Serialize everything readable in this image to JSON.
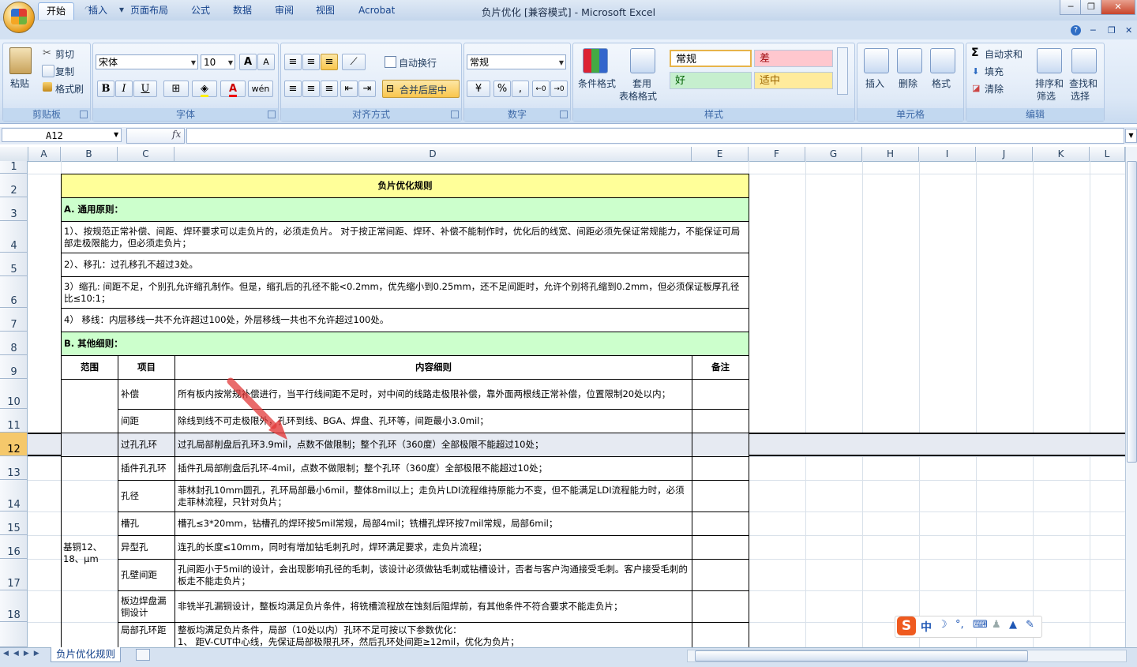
{
  "window": {
    "title": "负片优化  [兼容模式] - Microsoft Excel"
  },
  "tabs": [
    "开始",
    "插入",
    "页面布局",
    "公式",
    "数据",
    "审阅",
    "视图",
    "Acrobat"
  ],
  "ribbon": {
    "clipboard": {
      "paste": "粘贴",
      "cut": "剪切",
      "copy": "复制",
      "format_painter": "格式刷",
      "label": "剪贴板"
    },
    "font": {
      "name": "宋体",
      "size": "10",
      "bold": "B",
      "italic": "I",
      "underline": "U",
      "grow": "A",
      "shrink": "A",
      "label": "字体",
      "phonetic": "wén"
    },
    "alignment": {
      "wrap": "自动换行",
      "merge": "合并后居中",
      "label": "对齐方式"
    },
    "number": {
      "format": "常规",
      "percent": "%",
      "comma": ",",
      "label": "数字"
    },
    "styles": {
      "conditional": "条件格式",
      "table_format_1": "套用",
      "table_format_2": "表格格式",
      "normal": "常规",
      "bad": "差",
      "good": "好",
      "neutral": "适中",
      "label": "样式"
    },
    "cells": {
      "insert": "插入",
      "delete": "删除",
      "format": "格式",
      "label": "单元格"
    },
    "editing": {
      "autosum": "自动求和",
      "fill": "填充",
      "clear": "清除",
      "sort_1": "排序和",
      "sort_2": "筛选",
      "find_1": "查找和",
      "find_2": "选择",
      "label": "编辑"
    }
  },
  "formula_bar": {
    "name_box": "A12",
    "fx": "fx",
    "value": ""
  },
  "columns": [
    "A",
    "B",
    "C",
    "D",
    "E",
    "F",
    "G",
    "H",
    "I",
    "J",
    "K",
    "L"
  ],
  "rows": [
    "1",
    "2",
    "3",
    "4",
    "5",
    "6",
    "7",
    "8",
    "9",
    "10",
    "11",
    "12",
    "13",
    "14",
    "15",
    "16",
    "17",
    "18"
  ],
  "sheet": {
    "title": "负片优化规则",
    "section_a": "A.  通用原则：",
    "rule_1": "1）、按规范正常补偿、间距、焊环要求可以走负片的，必须走负片。 对于按正常间距、焊环、补偿不能制作时，优化后的线宽、间距必须先保证常规能力，不能保证可局部走极限能力，但必须走负片；",
    "rule_2": "2）、移孔：过孔移孔不超过3处。",
    "rule_3": "3）缩孔:   间距不足，个别孔允许缩孔制作。但是，缩孔后的孔径不能<0.2mm，优先缩小到0.25mm，还不足间距时，允许个别将孔缩到0.2mm，但必须保证板厚孔径比≤10:1；",
    "rule_4": "4） 移线：内层移线一共不允许超过100处，外层移线一共也不允许超过100处。",
    "section_b": "B.  其他细则：",
    "headers": {
      "scope": "范围",
      "item": "项目",
      "detail": "内容细则",
      "remark": "备注"
    },
    "scope_label": "基铜12、18、μm",
    "items": [
      {
        "item": "补偿",
        "detail": "所有板内按常规补偿进行，当平行线间距不足时，对中间的线路走极限补偿，靠外面两根线正常补偿，位置限制20处以内；"
      },
      {
        "item": "间距",
        "detail": "除线到线不可走极限外，孔环到线、BGA、焊盘、孔环等，间距最小3.0mil；"
      },
      {
        "item": "过孔孔环",
        "detail": "过孔局部削盘后孔环3.9mil，点数不做限制；整个孔环（360度）全部极限不能超过10处；"
      },
      {
        "item": "插件孔孔环",
        "detail": "插件孔局部削盘后孔环-4mil，点数不做限制；整个孔环（360度）全部极限不能超过10处；"
      },
      {
        "item": "孔径",
        "detail": "菲林封孔10mm圆孔，孔环局部最小6mil，整体8mil以上；走负片LDI流程维持原能力不变，但不能满足LDI流程能力时，必须走菲林流程，只针对负片；"
      },
      {
        "item": "槽孔",
        "detail": "槽孔≤3*20mm，钻槽孔的焊环按5mil常规，局部4mil；铣槽孔焊环按7mil常规，局部6mil；"
      },
      {
        "item": "异型孔",
        "detail": "连孔的长度≤10mm，同时有增加钻毛刺孔时，焊环满足要求，走负片流程；"
      },
      {
        "item": "孔壁间距",
        "detail": "孔间距小于5mil的设计，会出现影响孔径的毛刺，该设计必须做钻毛刺或钻槽设计，否者与客户沟通接受毛刺。客户接受毛刺的板走不能走负片；"
      },
      {
        "item": "板边焊盘漏铜设计",
        "detail": "非铣半孔漏铜设计，整板均满足负片条件，将铣槽流程放在蚀刻后阻焊前，有其他条件不符合要求不能走负片；"
      },
      {
        "item": "局部孔环距",
        "detail": "整板均满足负片条件，局部（10处以内）孔环不足可按以下参数优化：\n1、 距V-CUT中心线，先保证局部极限孔环，然后孔环处间距≥12mil，优化为负片；"
      }
    ]
  },
  "sheet_tabs": {
    "active": "负片优化规则"
  },
  "ime": {
    "lang": "中"
  }
}
